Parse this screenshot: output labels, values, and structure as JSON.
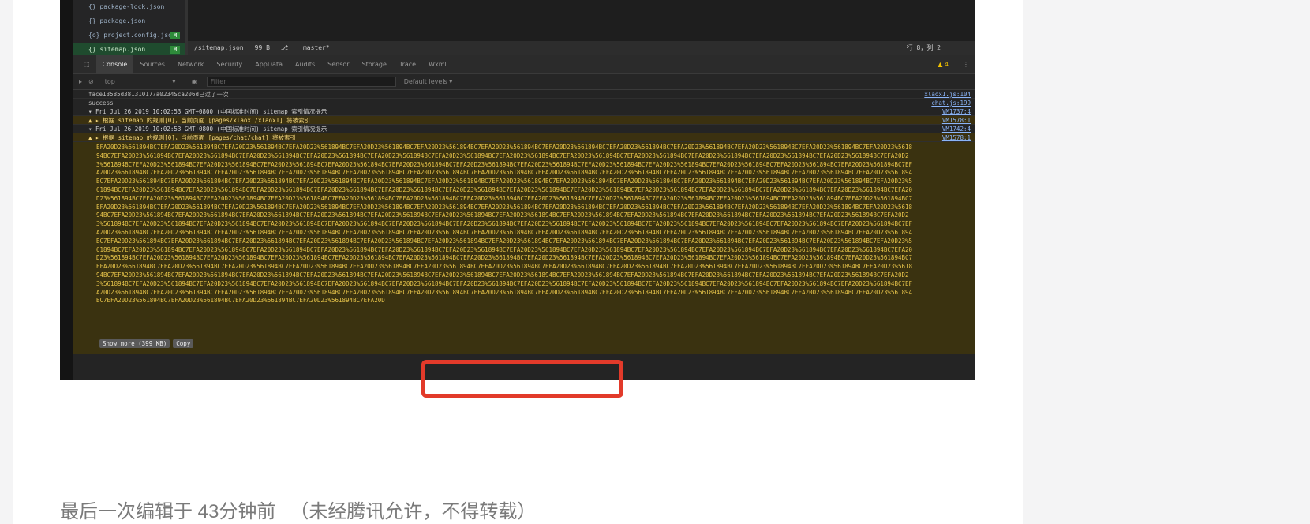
{
  "explorer": {
    "files": [
      {
        "name": "{} package-lock.json",
        "badge": ""
      },
      {
        "name": "{} package.json",
        "badge": ""
      },
      {
        "name": "{o} project.config.json",
        "badge": "M"
      },
      {
        "name": "{} sitemap.json",
        "badge": "M"
      }
    ]
  },
  "status_bar": {
    "file": "/sitemap.json",
    "size": "99 B",
    "branch": "master*",
    "position": "行 8，列 2"
  },
  "devtools": {
    "tabs": [
      "Console",
      "Sources",
      "Network",
      "Security",
      "AppData",
      "Audits",
      "Sensor",
      "Storage",
      "Trace",
      "Wxml"
    ],
    "warning_count": "▲ 4",
    "context": "top",
    "filter_placeholder": "Filter",
    "levels": "Default levels ▾"
  },
  "console_rows": [
    {
      "text": "face13585d381310177a0234Sca206d已过了一次",
      "source": "xlaox1.js:104",
      "kind": "plain"
    },
    {
      "text": "success",
      "source": "chat.js:199",
      "kind": "plain"
    },
    {
      "text": "▾ Fri Jul 26 2019 10:02:53 GMT+0800 (中国标准时间) sitemap 索引情况提示",
      "source": "VM1737:4",
      "kind": "group"
    },
    {
      "text": "▲ ▸ 根据 sitemap 的规则[0]，当前页面 [pages/xlaox1/xlaox1] 将被索引",
      "source": "VM1578:1",
      "kind": "warnrow"
    },
    {
      "text": "▾ Fri Jul 26 2019 10:02:53 GMT+0800 (中国标准时间) sitemap 索引情况提示",
      "source": "VM1742:4",
      "kind": "group"
    },
    {
      "text": "▲ ▸ 根据 sitemap 的规则[0]，当前页面 [pages/chat/chat] 将被索引",
      "source": "VM1578:1",
      "kind": "warnrow"
    }
  ],
  "warning_payload": {
    "show_more_label": "Show more (399 KB)",
    "copy_label": "Copy"
  },
  "footer": {
    "edited": "最后一次编辑于  43分钟前",
    "notice": "（未经腾讯允许，不得转载）"
  }
}
